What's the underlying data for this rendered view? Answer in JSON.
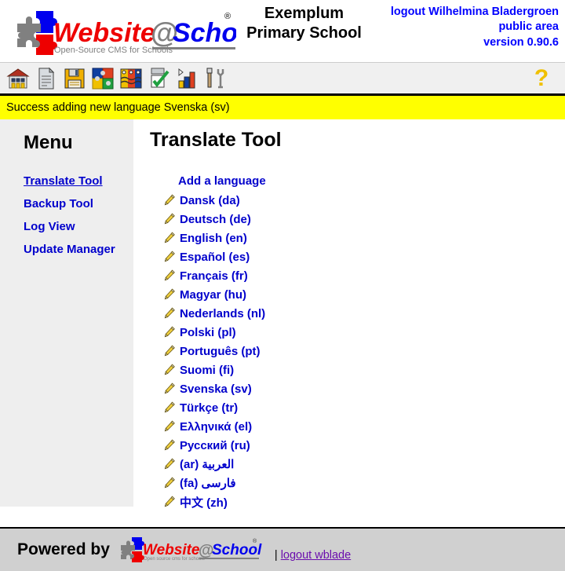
{
  "header": {
    "logo_alt": "Website@School",
    "logo_tagline": "Open-Source CMS for Schools",
    "logo_reg": "®",
    "school_name_line1": "Exemplum",
    "school_name_line2": "Primary School",
    "logout_label": "logout Wilhelmina Bladergroen",
    "area_label": "public area",
    "version_label": "version 0.90.6"
  },
  "toolbar": {
    "icons": [
      {
        "name": "school-icon",
        "title": "School"
      },
      {
        "name": "page-icon",
        "title": "Pages"
      },
      {
        "name": "save-floppy-icon",
        "title": "Save"
      },
      {
        "name": "modules-puzzle-icon",
        "title": "Modules"
      },
      {
        "name": "users-faces-icon",
        "title": "Users"
      },
      {
        "name": "approve-checkbox-icon",
        "title": "Approve"
      },
      {
        "name": "statistics-bars-icon",
        "title": "Statistics"
      },
      {
        "name": "tools-wrench-icon",
        "title": "Tools"
      }
    ],
    "help_label": "?"
  },
  "message": {
    "text": "Success adding new language Svenska (sv)",
    "background": "#ffff00",
    "color": "#000000"
  },
  "sidebar": {
    "title": "Menu",
    "items": [
      {
        "label": "Translate Tool",
        "active": true
      },
      {
        "label": "Backup Tool",
        "active": false
      },
      {
        "label": "Log View",
        "active": false
      },
      {
        "label": "Update Manager",
        "active": false
      }
    ]
  },
  "main": {
    "title": "Translate Tool",
    "add_language_label": "Add a language",
    "languages": [
      {
        "label": "Dansk (da)",
        "rtl": false
      },
      {
        "label": "Deutsch (de)",
        "rtl": false
      },
      {
        "label": "English (en)",
        "rtl": false
      },
      {
        "label": "Español (es)",
        "rtl": false
      },
      {
        "label": "Français (fr)",
        "rtl": false
      },
      {
        "label": "Magyar (hu)",
        "rtl": false
      },
      {
        "label": "Nederlands (nl)",
        "rtl": false
      },
      {
        "label": "Polski (pl)",
        "rtl": false
      },
      {
        "label": "Português (pt)",
        "rtl": false
      },
      {
        "label": "Suomi (fi)",
        "rtl": false
      },
      {
        "label": "Svenska (sv)",
        "rtl": false
      },
      {
        "label": "Türkçe (tr)",
        "rtl": false
      },
      {
        "label": "Ελληνικά (el)",
        "rtl": false
      },
      {
        "label": "Русский (ru)",
        "rtl": false
      },
      {
        "label": "العربية (ar)",
        "rtl": true
      },
      {
        "label": "فارسى (fa)",
        "rtl": true
      },
      {
        "label": "中文 (zh)",
        "rtl": false
      }
    ]
  },
  "footer": {
    "powered_by_label": "Powered by",
    "logo_alt": "Website@School",
    "logo_tagline": "Open source cms for schools",
    "separator": "|",
    "logout_label": "logout wblade"
  },
  "colors": {
    "link": "#0000cc",
    "header_link": "#0000ff",
    "visited_link": "#6a0dad",
    "sidebar_bg": "#eeeeee",
    "toolbar_bg": "#f0f0f0",
    "footer_bg": "#d0d0d0",
    "message_bg": "#ffff00",
    "help_icon": "#f0c000"
  }
}
